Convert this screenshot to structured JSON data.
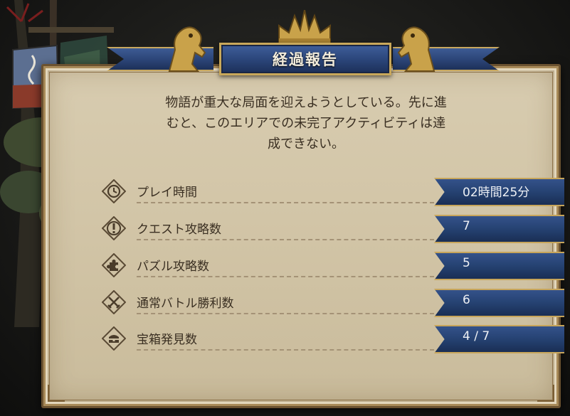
{
  "dialog": {
    "title": "経過報告",
    "description_lines": [
      "物語が重大な局面を迎えようとしている。先に進",
      "むと、このエリアでの未完了アクティビティは達",
      "成できない。"
    ]
  },
  "stats": [
    {
      "label": "プレイ時間",
      "value": "02時間25分",
      "icon": "clock-icon"
    },
    {
      "label": "クエスト攻略数",
      "value": "7",
      "icon": "exclamation-icon"
    },
    {
      "label": "パズル攻略数",
      "value": "5",
      "icon": "puzzle-icon"
    },
    {
      "label": "通常バトル勝利数",
      "value": "6",
      "icon": "crossed-swords-icon"
    },
    {
      "label": "宝箱発見数",
      "value": "4 / 7",
      "icon": "treasure-chest-icon"
    }
  ],
  "colors": {
    "parchment": "#d4c7a9",
    "banner_blue": "#2a4478",
    "gold_trim": "#c9a85a",
    "text_dark": "#3a2f22"
  }
}
